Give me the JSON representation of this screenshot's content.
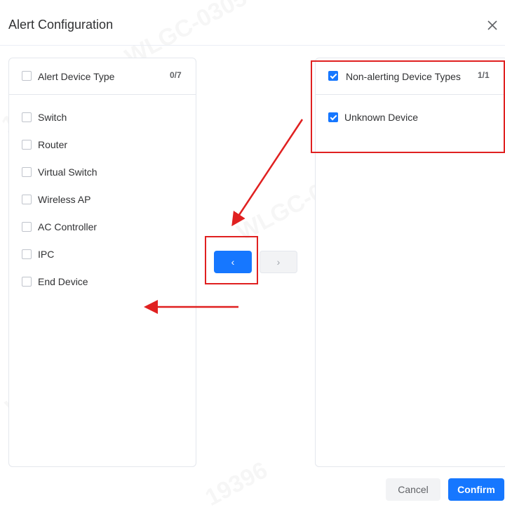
{
  "dialog": {
    "title": "Alert Configuration"
  },
  "left_panel": {
    "header_label": "Alert Device Type",
    "count": "0/7",
    "items": [
      {
        "label": "Switch"
      },
      {
        "label": "Router"
      },
      {
        "label": "Virtual Switch"
      },
      {
        "label": "Wireless AP"
      },
      {
        "label": "AC Controller"
      },
      {
        "label": "IPC"
      },
      {
        "label": "End Device"
      }
    ]
  },
  "right_panel": {
    "header_label": "Non-alerting Device Types",
    "count": "1/1",
    "items": [
      {
        "label": "Unknown Device",
        "checked": true
      }
    ]
  },
  "transfer": {
    "move_left_icon": "‹",
    "move_right_icon": "›"
  },
  "footer": {
    "cancel_label": "Cancel",
    "confirm_label": "Confirm"
  },
  "watermark": {
    "text_a": "WLGC-0305",
    "text_b": "19396"
  },
  "colors": {
    "primary": "#1677ff",
    "annotation": "#e02020",
    "border": "#e4e7ed"
  }
}
